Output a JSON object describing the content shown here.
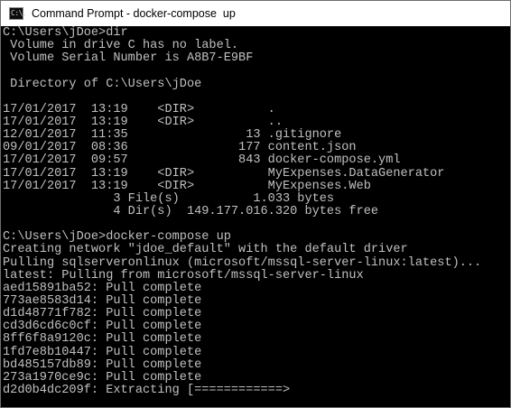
{
  "window": {
    "title": "Command Prompt - docker-compose  up",
    "icon": "command-prompt-icon",
    "icon_glyph": "C:\\."
  },
  "console": {
    "lines": [
      "C:\\Users\\jDoe>dir",
      " Volume in drive C has no label.",
      " Volume Serial Number is A8B7-E9BF",
      "",
      " Directory of C:\\Users\\jDoe",
      "",
      "17/01/2017  13:19    <DIR>          .",
      "17/01/2017  13:19    <DIR>          ..",
      "12/01/2017  11:35                13 .gitignore",
      "09/01/2017  08:36               177 content.json",
      "17/01/2017  09:57               843 docker-compose.yml",
      "17/01/2017  13:19    <DIR>          MyExpenses.DataGenerator",
      "17/01/2017  13:19    <DIR>          MyExpenses.Web",
      "               3 File(s)          1.033 bytes",
      "               4 Dir(s)  149.177.016.320 bytes free",
      "",
      "C:\\Users\\jDoe>docker-compose up",
      "Creating network \"jdoe_default\" with the default driver",
      "Pulling sqlserveronlinux (microsoft/mssql-server-linux:latest)...",
      "latest: Pulling from microsoft/mssql-server-linux",
      "aed15891ba52: Pull complete",
      "773ae8583d14: Pull complete",
      "d1d48771f782: Pull complete",
      "cd3d6cd6c0cf: Pull complete",
      "8ff6f8a9120c: Pull complete",
      "1fd7e8b10447: Pull complete",
      "bd485157db89: Pull complete",
      "273a1970ce9c: Pull complete",
      "d2d0b4dc209f: Extracting [============>"
    ]
  }
}
